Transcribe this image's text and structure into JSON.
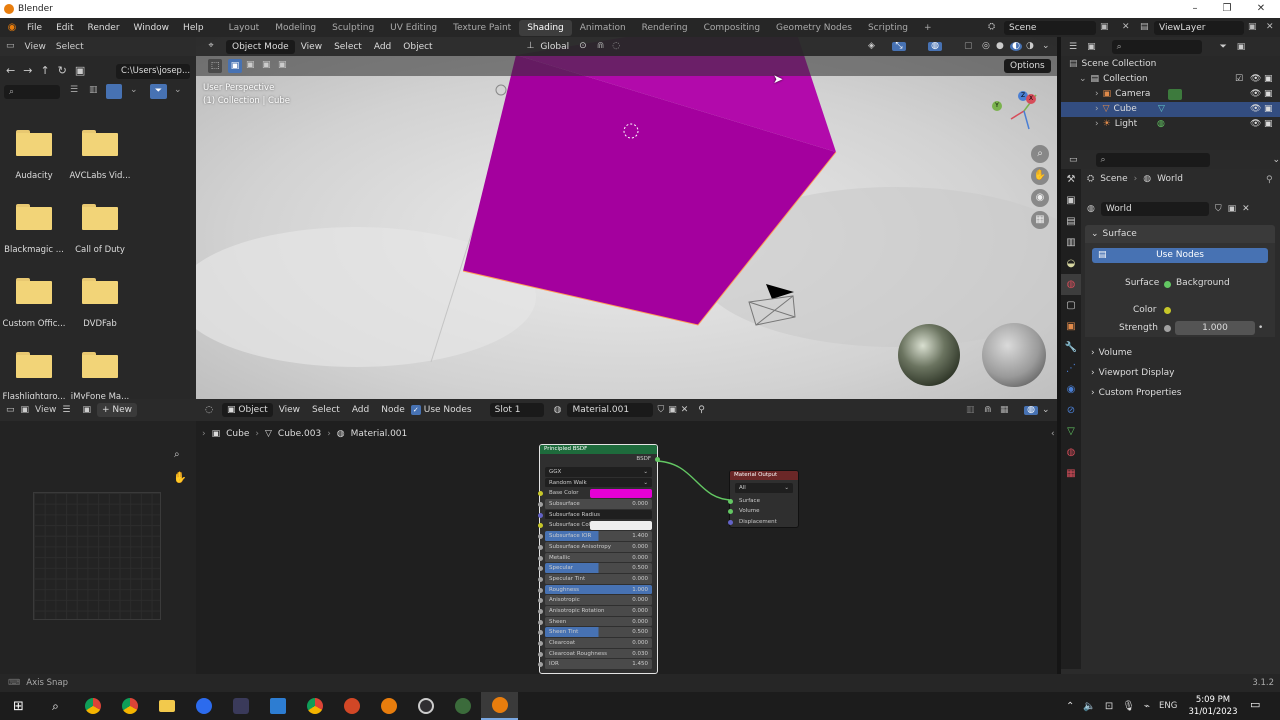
{
  "window": {
    "title": "Blender",
    "minimize": "–",
    "maximize": "❐",
    "close": "✕"
  },
  "menu": [
    "File",
    "Edit",
    "Render",
    "Window",
    "Help"
  ],
  "workspaces": [
    "Layout",
    "Modeling",
    "Sculpting",
    "UV Editing",
    "Texture Paint",
    "Shading",
    "Animation",
    "Rendering",
    "Compositing",
    "Geometry Nodes",
    "Scripting",
    "+"
  ],
  "active_workspace": "Shading",
  "scene": {
    "scene_name": "Scene",
    "view_layer": "ViewLayer"
  },
  "file_browser": {
    "menu": [
      "View",
      "Select"
    ],
    "path": "C:\\Users\\josep...",
    "folders": [
      "Audacity",
      "AVCLabs Vid...",
      "Blackmagic ...",
      "Call of Duty",
      "Custom Offic...",
      "DVDFab",
      "Flashlightgro...",
      "iMyFone Ma..."
    ]
  },
  "viewport": {
    "mode": "Object Mode",
    "menu": [
      "View",
      "Select",
      "Add",
      "Object"
    ],
    "transform": "Global",
    "options": "Options",
    "overlay_line1": "User Perspective",
    "overlay_line2": "(1) Collection | Cube",
    "cube_color": "#a4009e",
    "gizmo": {
      "y": "Y",
      "x": "X",
      "z": "Z"
    }
  },
  "node_editor": {
    "object_mode": "Object",
    "menu": [
      "View",
      "Select",
      "Add",
      "Node"
    ],
    "use_nodes": "Use Nodes",
    "slot": "Slot 1",
    "material": "Material.001",
    "breadcrumbs": [
      "Cube",
      "Cube.003",
      "Material.001"
    ],
    "principled": {
      "title": "Principled BSDF",
      "output": "BSDF",
      "distribution": "GGX",
      "subsurface_method": "Random Walk",
      "base_color_label": "Base Color",
      "base_color": "#e600d6",
      "rows": [
        {
          "label": "Subsurface",
          "value": "0.000",
          "fill": 0
        },
        {
          "label": "Subsurface Radius",
          "value": "",
          "fill": 0
        },
        {
          "label": "Subsurface Colo",
          "value": "",
          "fill": 0
        },
        {
          "label": "Subsurface IOR",
          "value": "1.400",
          "fill": 0.5
        },
        {
          "label": "Subsurface Anisotropy",
          "value": "0.000",
          "fill": 0
        },
        {
          "label": "Metallic",
          "value": "0.000",
          "fill": 0
        },
        {
          "label": "Specular",
          "value": "0.500",
          "fill": 0.5
        },
        {
          "label": "Specular Tint",
          "value": "0.000",
          "fill": 0
        },
        {
          "label": "Roughness",
          "value": "1.000",
          "fill": 1
        },
        {
          "label": "Anisotropic",
          "value": "0.000",
          "fill": 0
        },
        {
          "label": "Anisotropic Rotation",
          "value": "0.000",
          "fill": 0
        },
        {
          "label": "Sheen",
          "value": "0.000",
          "fill": 0
        },
        {
          "label": "Sheen Tint",
          "value": "0.500",
          "fill": 0.5
        },
        {
          "label": "Clearcoat",
          "value": "0.000",
          "fill": 0
        },
        {
          "label": "Clearcoat Roughness",
          "value": "0.030",
          "fill": 0
        },
        {
          "label": "IOR",
          "value": "1.450",
          "fill": 0
        }
      ]
    },
    "output_node": {
      "title": "Material Output",
      "target": "All",
      "inputs": [
        "Surface",
        "Volume",
        "Displacement"
      ]
    }
  },
  "left_editor": {
    "menu": [
      "View"
    ],
    "new": "New"
  },
  "outliner": {
    "items": [
      {
        "label": "Scene Collection",
        "indent": 0
      },
      {
        "label": "Collection",
        "indent": 1
      },
      {
        "label": "Camera",
        "indent": 2
      },
      {
        "label": "Cube",
        "indent": 2
      },
      {
        "label": "Light",
        "indent": 2
      }
    ],
    "selected": "Cube"
  },
  "properties": {
    "context_scene": "Scene",
    "context_world": "World",
    "world_name": "World",
    "surface_panel": "Surface",
    "use_nodes": "Use Nodes",
    "surface_label": "Surface",
    "surface_value": "Background",
    "color_label": "Color",
    "strength_label": "Strength",
    "strength_value": "1.000",
    "panels": [
      "Volume",
      "Viewport Display",
      "Custom Properties"
    ]
  },
  "status": {
    "left": "Axis Snap",
    "version": "3.1.2"
  },
  "taskbar": {
    "lang": "ENG",
    "time": "5:09 PM",
    "date": "31/01/2023"
  }
}
